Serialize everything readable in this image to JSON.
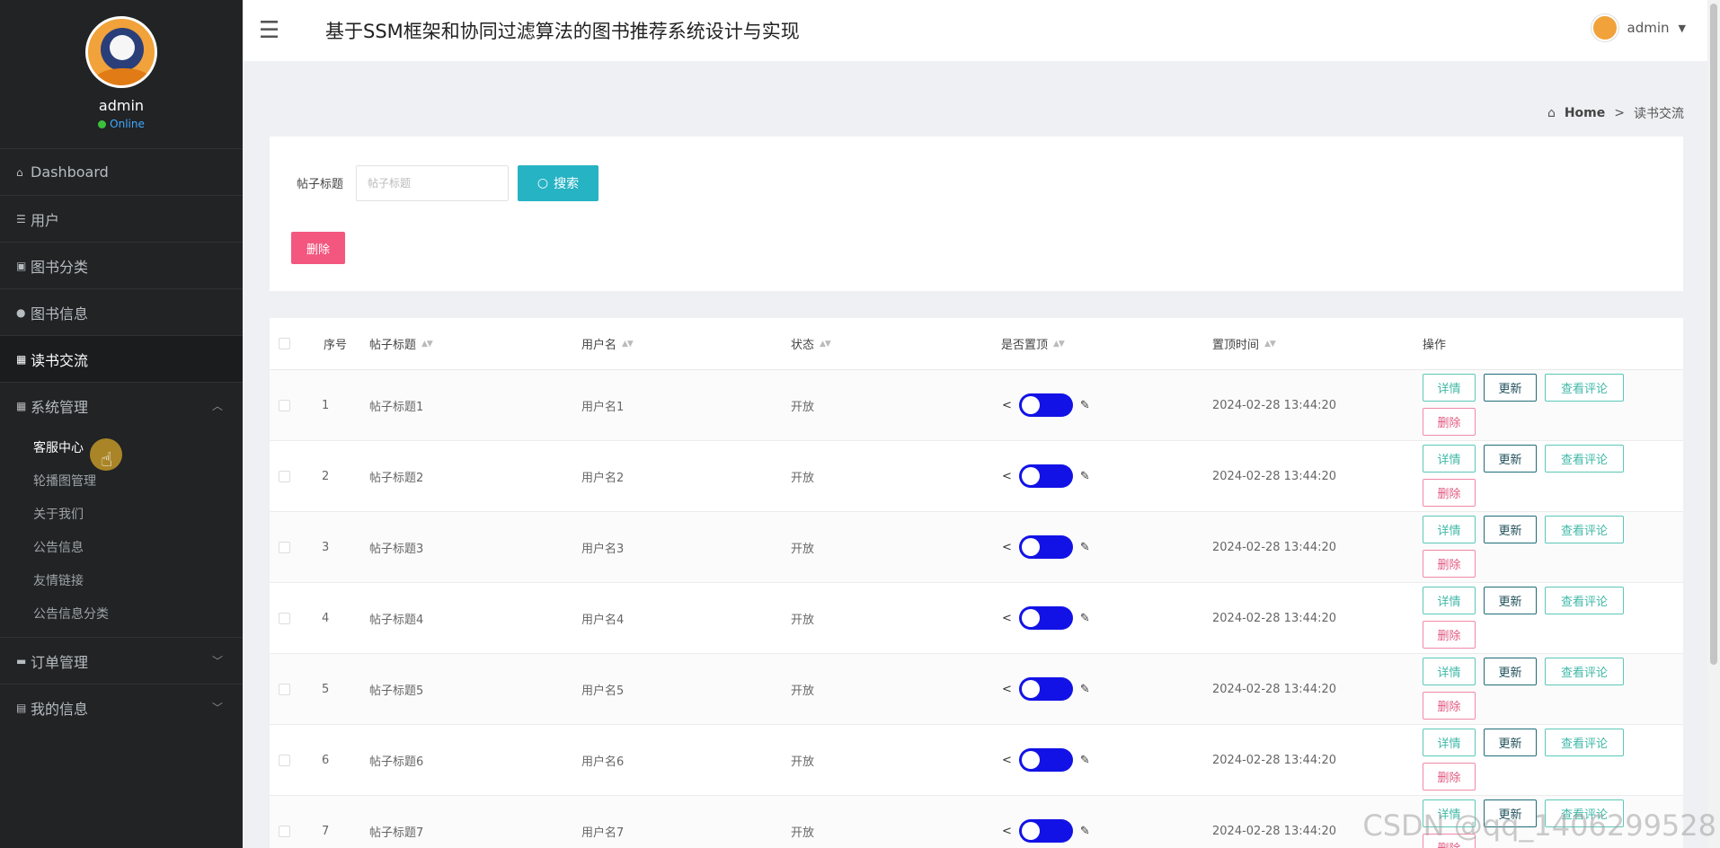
{
  "sidebar": {
    "username": "admin",
    "status": "Online",
    "menu": [
      {
        "label": "Dashboard",
        "icon": "home-icon"
      },
      {
        "label": "用户",
        "icon": "list-icon"
      },
      {
        "label": "图书分类",
        "icon": "calendar-icon"
      },
      {
        "label": "图书信息",
        "icon": "user-icon"
      },
      {
        "label": "读书交流",
        "icon": "grid-icon",
        "active": true
      },
      {
        "label": "系统管理",
        "icon": "grid-icon",
        "expanded": true
      }
    ],
    "submenu": [
      "客服中心",
      "轮播图管理",
      "关于我们",
      "公告信息",
      "友情链接",
      "公告信息分类"
    ],
    "menu_bottom": [
      {
        "label": "订单管理",
        "icon": "chat-icon"
      },
      {
        "label": "我的信息",
        "icon": "card-icon"
      }
    ]
  },
  "header": {
    "title": "基于SSM框架和协同过滤算法的图书推荐系统设计与实现",
    "user": "admin"
  },
  "breadcrumb": {
    "home": "Home",
    "separator": ">",
    "current": "读书交流"
  },
  "search": {
    "label": "帖子标题",
    "placeholder": "帖子标题",
    "button": "搜索",
    "delete_button": "删除"
  },
  "table": {
    "headers": [
      "序号",
      "帖子标题",
      "用户名",
      "状态",
      "是否置顶",
      "置顶时间",
      "操作"
    ],
    "rows": [
      {
        "id": "1",
        "title": "帖子标题1",
        "user": "用户名1",
        "status": "开放",
        "top": true,
        "time": "2024-02-28 13:44:20"
      },
      {
        "id": "2",
        "title": "帖子标题2",
        "user": "用户名2",
        "status": "开放",
        "top": true,
        "time": "2024-02-28 13:44:20"
      },
      {
        "id": "3",
        "title": "帖子标题3",
        "user": "用户名3",
        "status": "开放",
        "top": true,
        "time": "2024-02-28 13:44:20"
      },
      {
        "id": "4",
        "title": "帖子标题4",
        "user": "用户名4",
        "status": "开放",
        "top": true,
        "time": "2024-02-28 13:44:20"
      },
      {
        "id": "5",
        "title": "帖子标题5",
        "user": "用户名5",
        "status": "开放",
        "top": true,
        "time": "2024-02-28 13:44:20"
      },
      {
        "id": "6",
        "title": "帖子标题6",
        "user": "用户名6",
        "status": "开放",
        "top": true,
        "time": "2024-02-28 13:44:20"
      },
      {
        "id": "7",
        "title": "帖子标题7",
        "user": "用户名7",
        "status": "开放",
        "top": true,
        "time": "2024-02-28 13:44:20"
      }
    ],
    "actions": {
      "detail": "详情",
      "update": "更新",
      "view_comments": "查看评论",
      "delete": "删除"
    }
  },
  "watermark": "CSDN @qq_1406299528",
  "colors": {
    "sidebar_bg": "#212325",
    "accent_teal": "#26b3c4",
    "danger": "#f3577f",
    "toggle": "#1212e6"
  }
}
